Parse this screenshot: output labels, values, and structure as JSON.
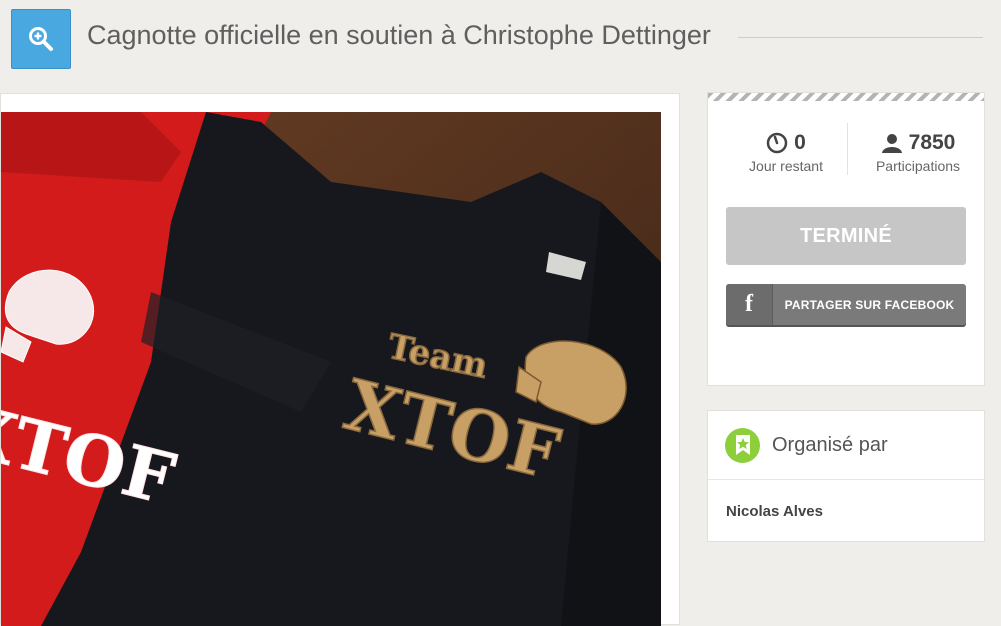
{
  "header": {
    "title": "Cagnotte officielle en soutien à Christophe Dettinger",
    "zoom_icon": "zoom-in-icon"
  },
  "media": {
    "image_subject": "t-shirts",
    "shirt_text_black_1": "Team",
    "shirt_text_black_2": "XTOF",
    "shirt_text_red": "XTOF"
  },
  "stats": {
    "days_value": "0",
    "days_label": "Jour restant",
    "days_icon": "clock-icon",
    "participations_value": "7850",
    "participations_label": "Participations",
    "participations_icon": "user-icon"
  },
  "actions": {
    "status_button": "TERMINÉ",
    "share_button": "PARTAGER SUR FACEBOOK",
    "share_icon_letter": "f"
  },
  "organiser": {
    "heading": "Organisé par",
    "name": "Nicolas Alves",
    "badge_icon": "bookmark-icon"
  },
  "colors": {
    "background": "#efeeeb",
    "zoom_button": "#4aa8e0",
    "done_button": "#c6c6c6",
    "facebook_button": "#7a7a7a",
    "organiser_badge": "#8ccf3a"
  }
}
